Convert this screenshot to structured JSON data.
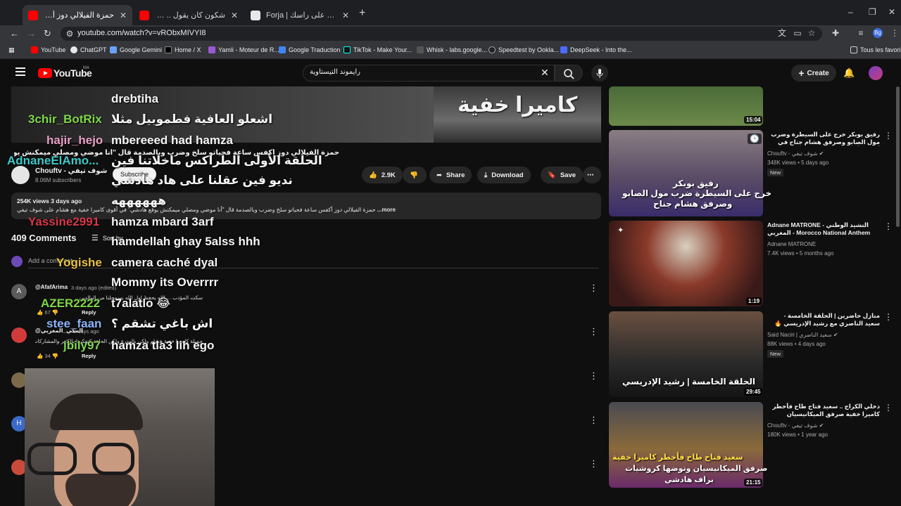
{
  "browser": {
    "tabs": [
      {
        "title": "حمزة الفيلالي دوز أكفس ساعة فـ",
        "active": true,
        "close": "✕"
      },
      {
        "title": "شكون كان يقول .. وسيمة المبل",
        "active": false,
        "close": "✕"
      },
      {
        "title": "Forja | ضحك على راسك",
        "active": false,
        "close": "✕"
      }
    ],
    "new_tab": "+",
    "window_controls": [
      "–",
      "❐",
      "✕"
    ],
    "nav": {
      "back": "←",
      "forward": "→",
      "reload": "↻"
    },
    "url": "youtube.com/watch?v=vRObxMIVYI8",
    "account_initial": "Bg",
    "bookmarks": [
      "YouTube",
      "ChatGPT",
      "Google Gemini",
      "Home / X",
      "Yamli - Moteur de R...",
      "Google Traduction",
      "TikTok - Make Your...",
      "Whisk - labs.google...",
      "Speedtest by Ookla...",
      "DeepSeek - Into the..."
    ],
    "all_bookmarks": "Tous les favoris"
  },
  "youtube": {
    "logo_text": "YouTube",
    "logo_region": "MA",
    "search_value": "رايموند التيستاوية",
    "create_label": "Create",
    "video_overlay_title": "كاميرا خفية",
    "video_title": "حمزة الفيلالي دوز أكفس ساعة فحياتو سلخ وضرب وبالصدمة قال \"أنا موضي ومصلي ميمكنش يوقع هادشي\"",
    "channel": {
      "name": "Chouftv - شوف تيفي",
      "subscribers": "8.06M subscribers",
      "subscribe_label": "Subscribe"
    },
    "actions": {
      "likes": "2.9K",
      "share": "Share",
      "download": "Download",
      "save": "Save"
    },
    "description": {
      "meta": "254K views  3 days ago",
      "text": "حمزة الفيلالي دوز أكفس ساعة فحياتو سلخ وضرب وبالصدمة قال \"أنا موضي ومصلي ميمكنش يوقع هادشي\" في أقوى كاميرا خفية مع هشام على شوف تيفي",
      "more": "...more"
    },
    "comments": {
      "count": "409 Comments",
      "sort_label": "Sort by",
      "add_placeholder": "Add a comment...",
      "items": [
        {
          "author": "@AfafArima",
          "meta": "3 days ago (edited)",
          "text": "سكت المؤدب ... الله يحفظ اول الله يسمحلنا من الوالدين",
          "likes": "67",
          "reply": "Reply"
        },
        {
          "author": "@المكي_المغربي",
          "meta": "3 days ago",
          "text": "جميلة كاميرا خفية هشام ولكن بالهدرة ولكن الحلقة كتفكرنا بالكثير والمشاركات",
          "likes": "34",
          "reply": "Reply"
        }
      ]
    }
  },
  "chat_overlay": [
    {
      "user": "",
      "msg": "drebtiha",
      "color": "#ffffff"
    },
    {
      "user": "3chir_BotRix",
      "msg": "اشعلو العافية فطموبيل مثلا",
      "color": "#7fd84a"
    },
    {
      "user": "hajir_hejo",
      "msg": "mbereeed had hamza",
      "color": "#e8a0c8"
    },
    {
      "user": "AdnaneElAmo...",
      "msg": "الحلقة الأولى الطراكس ماخلاتنا فين",
      "color": "#3ec8c8"
    },
    {
      "user": "",
      "msg": "نديو فين عقلنا على هاد هادشي",
      "color": "#ffffff"
    },
    {
      "user": "",
      "msg": "ههههههه",
      "color": "#ffffff"
    },
    {
      "user": "Yassine2991",
      "msg": "hamza mbard 3arf",
      "color": "#d8384a"
    },
    {
      "user": "",
      "msg": "hamdellah ghay 5alss hhh",
      "color": "#ffffff"
    },
    {
      "user": "Yogishe",
      "msg": "camera caché dyal",
      "color": "#e8c040"
    },
    {
      "user": "",
      "msg": "Mommy its Overrrr",
      "color": "#ffffff"
    },
    {
      "user": "AZER2222",
      "msg": "t7alatlo 😂",
      "color": "#7fd84a"
    },
    {
      "user": "stee_faan",
      "msg": "اش باغي تشقم ؟",
      "color": "#8ab4f8"
    },
    {
      "user": "jbily97",
      "msg": "hamza tla3 lih ego",
      "color": "#7fd84a"
    }
  ],
  "sidebar": [
    {
      "duration": "15:04",
      "title": "",
      "channel": "",
      "views": ""
    },
    {
      "duration": "",
      "thumb_text_1": "رفيق بوبكر",
      "thumb_text_2": "خرج على السيطرة ضرب مول الصابو",
      "thumb_text_3": "وصرفق هشام جناح",
      "title": "رفيق بوبكر خرج على السيطرة وضرب مول الصابو وصرفق هشام جناح في أقوى وأخطر كاميرا كاشي",
      "channel": "Chouftv - شوف تيفي",
      "views": "348K views • 5 days ago",
      "badge": "New"
    },
    {
      "duration": "1:19",
      "title": "Adnane MATRONE - النشيد الوطني المغربي - Morocco National Anthem",
      "channel": "Adnane MATRONE",
      "views": "7.4K views • 5 months ago"
    },
    {
      "duration": "29:45",
      "thumb_text_1": "الحلقة الخامسة | رشيد الإدريسي",
      "title": "منازل حاضرين | الحلقة الخامسة - سعيد الناصري مع رشيد الإدريسي 🔥",
      "channel": "Said Naciri | سعيد الناصري",
      "views": "88K views • 4 days ago",
      "badge": "New"
    },
    {
      "duration": "21:15",
      "thumb_text_1": "سعيد فتاح طاح فأخطر كاميرا خفية",
      "thumb_text_2": "صرفق الميكانيسيان ونوضها كروشيات",
      "thumb_text_3": "براف هادشي",
      "title": "دخلي الكراج .. سعيد فتاح طاح فأخطر كاميرا خفية صرفق الميكانيسيان ونوضها كروشيات .. براف",
      "channel": "Chouftv - شوف تيفي",
      "views": "180K views • 1 year ago"
    }
  ]
}
